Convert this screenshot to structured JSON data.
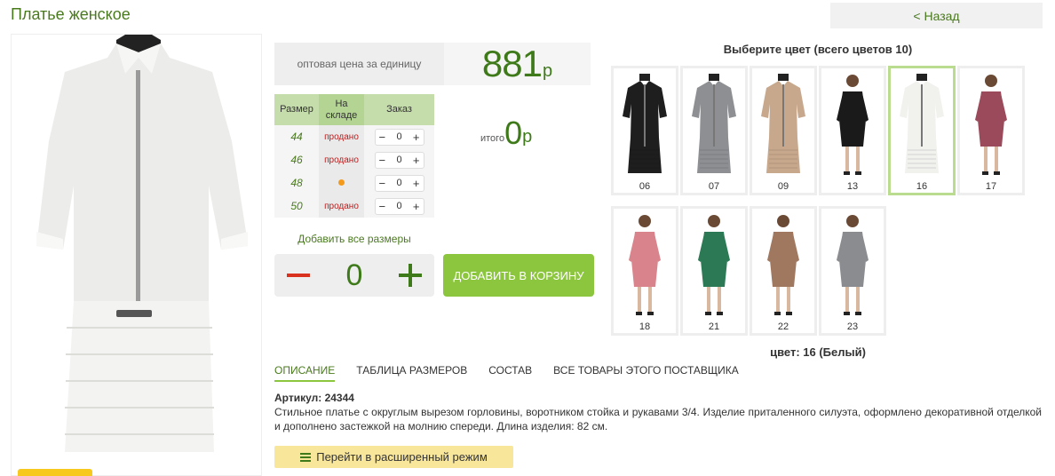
{
  "page": {
    "title": "Платье женское",
    "back_label": "< Назад"
  },
  "price": {
    "label": "оптовая цена за единицу",
    "value": "881",
    "currency": "р"
  },
  "size_table": {
    "headers": [
      "Размер",
      "На складе",
      "Заказ"
    ],
    "rows": [
      {
        "size": "44",
        "status": "продано",
        "qty": "0"
      },
      {
        "size": "46",
        "status": "продано",
        "qty": "0"
      },
      {
        "size": "48",
        "status": "",
        "qty": "0"
      },
      {
        "size": "50",
        "status": "продано",
        "qty": "0"
      }
    ],
    "stepper_minus": "−",
    "stepper_plus": "+"
  },
  "total": {
    "label": "итого",
    "value": "0",
    "currency": "р"
  },
  "add_all": {
    "label": "Добавить все размеры",
    "qty": "0"
  },
  "cart_button": "ДОБАВИТЬ В КОРЗИНУ",
  "colors": {
    "title": "Выберите цвет (всего цветов 10)",
    "items": [
      {
        "num": "06",
        "color": "#1e1e1e"
      },
      {
        "num": "07",
        "color": "#8d8f92"
      },
      {
        "num": "09",
        "color": "#c8a88c"
      },
      {
        "num": "13",
        "color": "#1a1a1a"
      },
      {
        "num": "16",
        "color": "#f1f1ee"
      },
      {
        "num": "17",
        "color": "#9a4a5a"
      },
      {
        "num": "18",
        "color": "#d9848c"
      },
      {
        "num": "21",
        "color": "#2c7a55"
      },
      {
        "num": "22",
        "color": "#a07860"
      },
      {
        "num": "23",
        "color": "#8a8c90"
      }
    ],
    "selected": "16",
    "caption": "цвет: 16 (Белый)"
  },
  "tabs": [
    "ОПИСАНИЕ",
    "ТАБЛИЦА РАЗМЕРОВ",
    "СОСТАВ",
    "ВСЕ ТОВАРЫ ЭТОГО ПОСТАВЩИКА"
  ],
  "article": "Артикул: 24344",
  "description": "Стильное платье с округлым вырезом горловины, воротником стойка и рукавами 3/4. Изделие приталенного силуэта, оформлено декоративной отделкой и дополнено застежкой на молнию спереди. Длина изделия: 82 см.",
  "advanced_button": "Перейти в расширенный режим"
}
